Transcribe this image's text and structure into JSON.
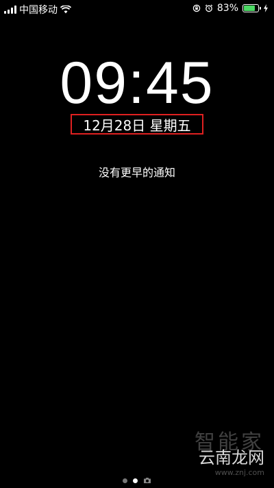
{
  "status_bar": {
    "carrier": "中国移动",
    "battery_percent": "83%",
    "battery_level": 0.83,
    "icons": [
      "signal-bars-icon",
      "wifi-icon",
      "rotation-lock-icon",
      "alarm-icon",
      "battery-icon",
      "charging-bolt-icon"
    ]
  },
  "lockscreen": {
    "time": "09:45",
    "date": "12月28日 星期五",
    "notice": "没有更早的通知",
    "highlight_color": "#e02020"
  },
  "page_indicator": {
    "count": 3,
    "active_index": 1
  },
  "watermark": {
    "line1": "智能家",
    "line2": "云南龙网",
    "line3": "www.znj.com"
  }
}
